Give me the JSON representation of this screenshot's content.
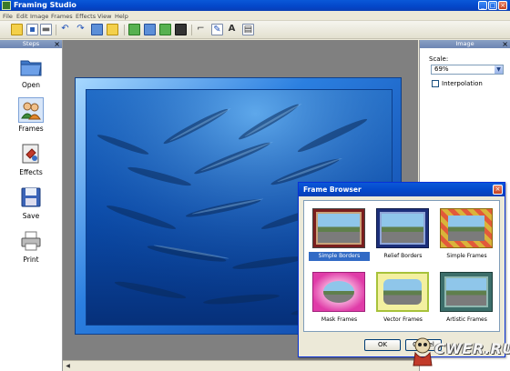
{
  "window": {
    "title": "Framing Studio",
    "minimize": "_",
    "maximize": "□",
    "close": "×"
  },
  "menu": [
    "File",
    "Edit",
    "Image",
    "Frames",
    "Effects",
    "View",
    "Help"
  ],
  "toolbar_icons": [
    "new-icon",
    "open-icon",
    "save-icon",
    "print-icon",
    "undo-icon",
    "redo-icon",
    "copy-icon",
    "paste-icon",
    "frame-icon",
    "border-icon",
    "image-icon",
    "crop-icon",
    "rotate-icon",
    "edit-icon",
    "text-icon",
    "size-icon"
  ],
  "steps_panel": {
    "title": "Steps",
    "close": "×",
    "items": [
      {
        "label": "Open",
        "icon": "folder-icon"
      },
      {
        "label": "Frames",
        "icon": "people-icon"
      },
      {
        "label": "Effects",
        "icon": "effects-icon"
      },
      {
        "label": "Save",
        "icon": "floppy-icon"
      },
      {
        "label": "Print",
        "icon": "printer-icon"
      }
    ]
  },
  "image_panel": {
    "title": "Image",
    "close": "×",
    "scale_label": "Scale:",
    "scale_value": "69%",
    "interpolation_label": "Interpolation",
    "interpolation_checked": false
  },
  "frame_browser": {
    "title": "Frame Browser",
    "close": "×",
    "frames": [
      {
        "label": "Simple Borders",
        "selected": true,
        "border_color": "#7a1d1d",
        "mat_color": "#c9a37a"
      },
      {
        "label": "Relief Borders",
        "selected": false,
        "border_color": "#1c2f7a",
        "mat_color": "#8fa6d8"
      },
      {
        "label": "Simple Frames",
        "selected": false,
        "border_color": "#d9b43a",
        "mat_color": "#e25a3a"
      },
      {
        "label": "Mask Frames",
        "selected": false,
        "border_color": "#e03ca8",
        "mat_color": "#f4a2d6"
      },
      {
        "label": "Vector Frames",
        "selected": false,
        "border_color": "#a7c23a",
        "mat_color": "#f3f0a0"
      },
      {
        "label": "Artistic Frames",
        "selected": false,
        "border_color": "#3c6e6a",
        "mat_color": "#8fb8b0"
      }
    ],
    "ok_label": "OK",
    "cancel_label": "Cancel"
  },
  "watermark": {
    "text": "CWER.RU"
  },
  "colors": {
    "accent": "#0a58d8",
    "canvas": "#808080",
    "photo_blue": "#1e6fcf"
  }
}
